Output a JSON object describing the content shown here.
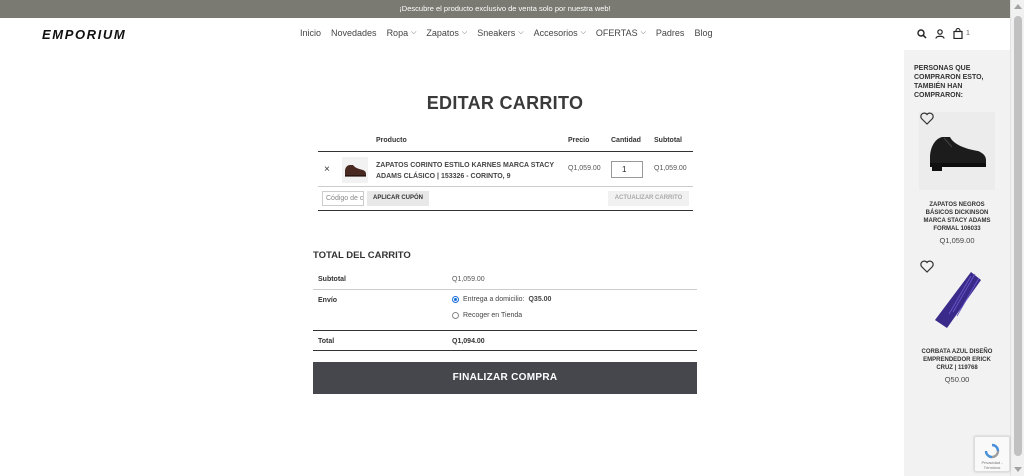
{
  "announcement": "¡Descubre el producto exclusivo de venta solo por nuestra web!",
  "header": {
    "logo": "EMPORIUM",
    "nav": [
      {
        "label": "Inicio",
        "dropdown": false
      },
      {
        "label": "Novedades",
        "dropdown": false
      },
      {
        "label": "Ropa",
        "dropdown": true
      },
      {
        "label": "Zapatos",
        "dropdown": true
      },
      {
        "label": "Sneakers",
        "dropdown": true
      },
      {
        "label": "Accesorios",
        "dropdown": true
      },
      {
        "label": "OFERTAS",
        "dropdown": true
      },
      {
        "label": "Padres",
        "dropdown": false
      },
      {
        "label": "Blog",
        "dropdown": false
      }
    ],
    "cart_count": "1"
  },
  "page_title": "EDITAR CARRITO",
  "cart": {
    "headers": {
      "product": "Producto",
      "price": "Precio",
      "quantity": "Cantidad",
      "subtotal": "Subtotal"
    },
    "items": [
      {
        "remove": "×",
        "name": "ZAPATOS CORINTO ESTILO KARNES MARCA STACY ADAMS CLÁSICO | 153326 - CORINTO, 9",
        "price": "Q1,059.00",
        "quantity": "1",
        "subtotal": "Q1,059.00"
      }
    ],
    "coupon_placeholder": "Código de cupón",
    "apply_coupon": "APLICAR CUPÓN",
    "update_cart": "ACTUALIZAR CARRITO"
  },
  "totals": {
    "title": "TOTAL DEL CARRITO",
    "subtotal_label": "Subtotal",
    "subtotal_value": "Q1,059.00",
    "shipping_label": "Envío",
    "shipping_option1_label": "Entrega a domicilio:",
    "shipping_option1_price": "Q35.00",
    "shipping_option2_label": "Recoger en Tienda",
    "total_label": "Total",
    "total_value": "Q1,094.00"
  },
  "checkout_button": "FINALIZAR COMPRA",
  "sidebar": {
    "title": "PERSONAS QUE COMPRARON ESTO, TAMBIÉN HAN COMPRARON:",
    "products": [
      {
        "name": "ZAPATOS NEGROS BÁSICOS DICKINSON MARCA STACY ADAMS FORMAL 106033",
        "price": "Q1,059.00",
        "icon": "black-shoe-icon"
      },
      {
        "name": "CORBATA AZUL DISEÑO EMPRENDEDOR ERICK CRUZ | 119768",
        "price": "Q50.00",
        "icon": "blue-tie-icon"
      }
    ]
  },
  "recaptcha": {
    "label": "Privacidad - Términos"
  },
  "colors": {
    "announcement_bg": "#7a7a72",
    "checkout_bg": "#45474d",
    "sidebar_bg": "#f2f2f2"
  }
}
